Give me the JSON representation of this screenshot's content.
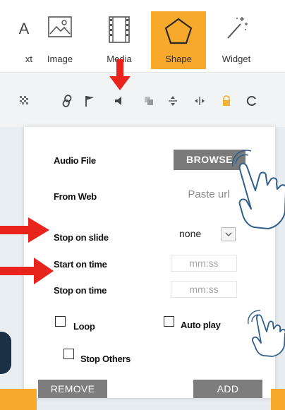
{
  "toolbar": {
    "items": [
      {
        "label": "xt",
        "icon": "text-icon",
        "partial_glyph": "A"
      },
      {
        "label": "Image",
        "icon": "image-icon"
      },
      {
        "label": "Media",
        "icon": "media-film-icon"
      },
      {
        "label": "Shape",
        "icon": "pentagon-icon",
        "active": true
      },
      {
        "label": "Widget",
        "icon": "magic-wand-icon"
      }
    ]
  },
  "iconbar": {
    "icons": [
      "checkerboard-icon",
      "link-icon",
      "flag-icon",
      "speaker-icon",
      "layers-icon",
      "align-vertical-icon",
      "align-horizontal-icon",
      "lock-icon",
      "refresh-icon"
    ]
  },
  "panel": {
    "audio_file_label": "Audio File",
    "browse_label": "BROWSE",
    "from_web_label": "From Web",
    "url_placeholder": "Paste url",
    "stop_on_slide_label": "Stop on slide",
    "stop_on_slide_value": "none",
    "start_on_time_label": "Start on time",
    "start_on_time_placeholder": "mm:ss",
    "stop_on_time_label": "Stop on time",
    "stop_on_time_placeholder": "mm:ss",
    "loop_label": "Loop",
    "loop_checked": false,
    "auto_play_label": "Auto play",
    "auto_play_checked": false,
    "stop_others_label": "Stop Others",
    "stop_others_checked": false,
    "remove_label": "REMOVE",
    "add_label": "ADD"
  },
  "colors": {
    "accent": "#f7a92b",
    "annotation_arrow": "#e8241c",
    "button_gray": "#7d7d7d",
    "hand_outline": "#2f5f8a"
  }
}
